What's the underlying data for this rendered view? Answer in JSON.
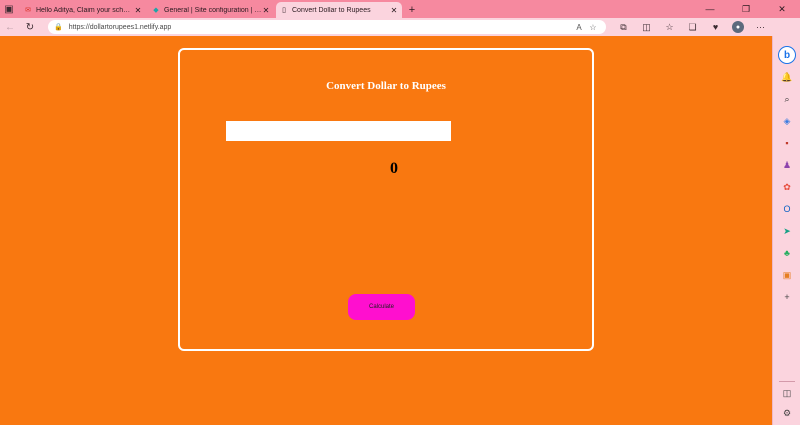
{
  "browser": {
    "tabs": [
      {
        "title": "Hello Aditya, Claim your scholar",
        "favicon": "✉",
        "active": false
      },
      {
        "title": "General | Site configuration | dol",
        "favicon": "◆",
        "active": false
      },
      {
        "title": "Convert Dollar to Rupees",
        "favicon": "▯",
        "active": true
      }
    ],
    "url": "https://dollartorupees1.netlify.app",
    "window_controls": {
      "minimize": "—",
      "restore": "❐",
      "close": "✕"
    },
    "icons": {
      "tab_actions": "▣",
      "new_tab": "+",
      "back": "←",
      "refresh": "↻",
      "lock": "🔒",
      "read_aloud": "A",
      "favorite_star": "☆",
      "extensions": "⧉",
      "split_screen": "◫",
      "favorites": "☆",
      "collections": "❏",
      "performance": "♥",
      "avatar": "●",
      "menu": "···",
      "tab_close": "✕"
    }
  },
  "page": {
    "title": "Convert Dollar to Rupees",
    "input_value": "",
    "result": "0",
    "calculate_label": "Calculate",
    "colors": {
      "background": "#f97810",
      "card_border": "#ffffff",
      "button": "#ff0fcf"
    }
  },
  "sidebar": {
    "icons": [
      {
        "name": "bell-icon",
        "glyph": "🔔",
        "color": "#2d6fd1"
      },
      {
        "name": "search-icon",
        "glyph": "⌕",
        "color": "#333333"
      },
      {
        "name": "shopping-tag-icon",
        "glyph": "◈",
        "color": "#3a7be0"
      },
      {
        "name": "toolbox-icon",
        "glyph": "▪",
        "color": "#c0392b"
      },
      {
        "name": "games-icon",
        "glyph": "♟",
        "color": "#8e44ad"
      },
      {
        "name": "microsoft365-icon",
        "glyph": "✿",
        "color": "#e74c3c"
      },
      {
        "name": "outlook-icon",
        "glyph": "O",
        "color": "#0b62c4"
      },
      {
        "name": "send-icon",
        "glyph": "➤",
        "color": "#16a085"
      },
      {
        "name": "tree-icon",
        "glyph": "♣",
        "color": "#27ae60"
      },
      {
        "name": "drop-icon",
        "glyph": "▣",
        "color": "#e67e22"
      },
      {
        "name": "add-icon",
        "glyph": "+",
        "color": "#444444"
      },
      {
        "name": "sidebar-toggle-icon",
        "glyph": "◫",
        "color": "#444444"
      },
      {
        "name": "settings-icon",
        "glyph": "⚙",
        "color": "#444444"
      }
    ],
    "copilot_label": "b"
  }
}
